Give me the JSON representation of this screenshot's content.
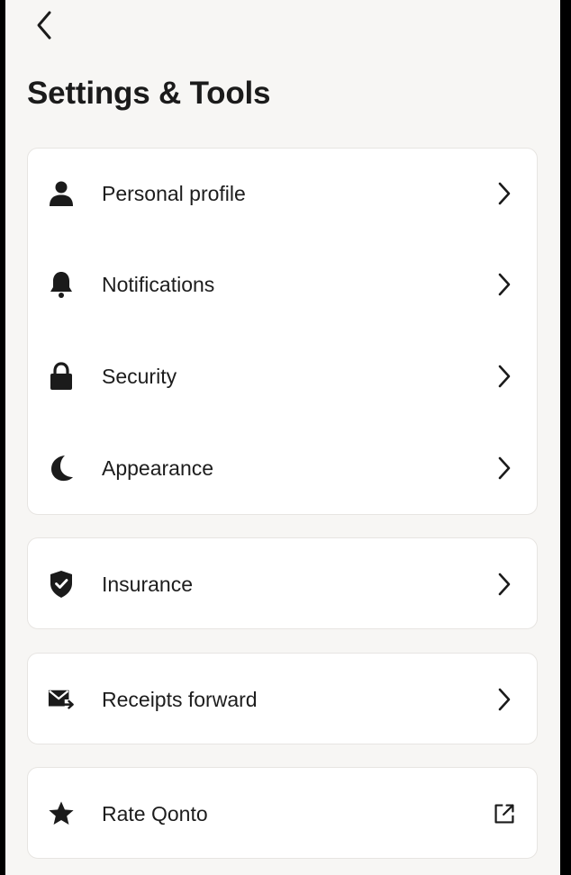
{
  "header": {
    "title": "Settings & Tools",
    "back_icon": "chevron-left-icon"
  },
  "groups": [
    {
      "items": [
        {
          "label": "Personal profile",
          "icon": "person-icon",
          "trailing": "chevron-right-icon"
        },
        {
          "label": "Notifications",
          "icon": "bell-icon",
          "trailing": "chevron-right-icon"
        },
        {
          "label": "Security",
          "icon": "lock-icon",
          "trailing": "chevron-right-icon"
        },
        {
          "label": "Appearance",
          "icon": "moon-icon",
          "trailing": "chevron-right-icon"
        }
      ]
    },
    {
      "items": [
        {
          "label": "Insurance",
          "icon": "shield-check-icon",
          "trailing": "chevron-right-icon"
        }
      ]
    },
    {
      "items": [
        {
          "label": "Receipts forward",
          "icon": "mail-forward-icon",
          "trailing": "chevron-right-icon"
        }
      ]
    },
    {
      "items": [
        {
          "label": "Rate Qonto",
          "icon": "star-icon",
          "trailing": "external-link-icon"
        }
      ]
    }
  ],
  "colors": {
    "background": "#f7f6f4",
    "card": "#ffffff",
    "text": "#1d1d1d",
    "border": "#e7e5e2"
  }
}
